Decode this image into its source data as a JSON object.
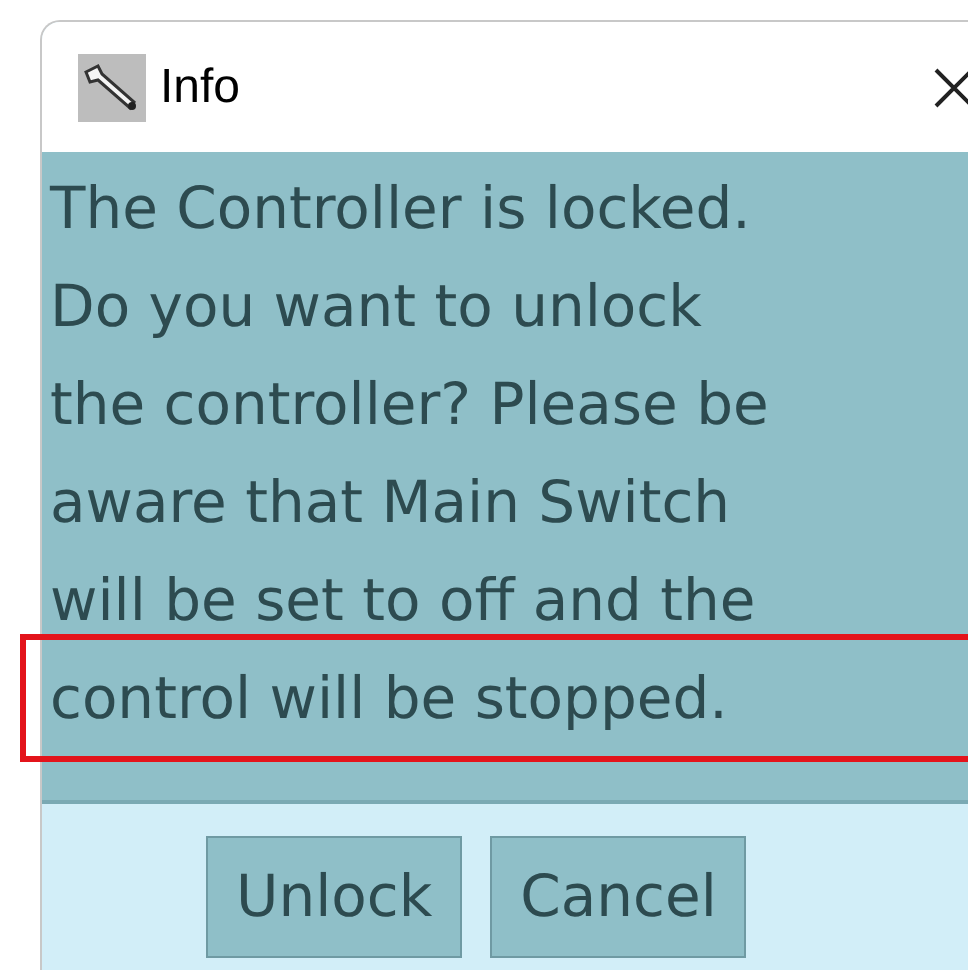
{
  "window": {
    "title": "Info"
  },
  "message_lines": [
    {
      "text": "The Controller is locked.",
      "highlighted": false
    },
    {
      "text": "Do you want to unlock",
      "highlighted": false
    },
    {
      "text": "the controller? Please be",
      "highlighted": false
    },
    {
      "text": "aware that Main Switch",
      "highlighted": false
    },
    {
      "text": "will be set to off and the",
      "highlighted": false
    },
    {
      "text": "control will be stopped.",
      "highlighted": true
    }
  ],
  "buttons": [
    "Unlock",
    "Cancel"
  ]
}
